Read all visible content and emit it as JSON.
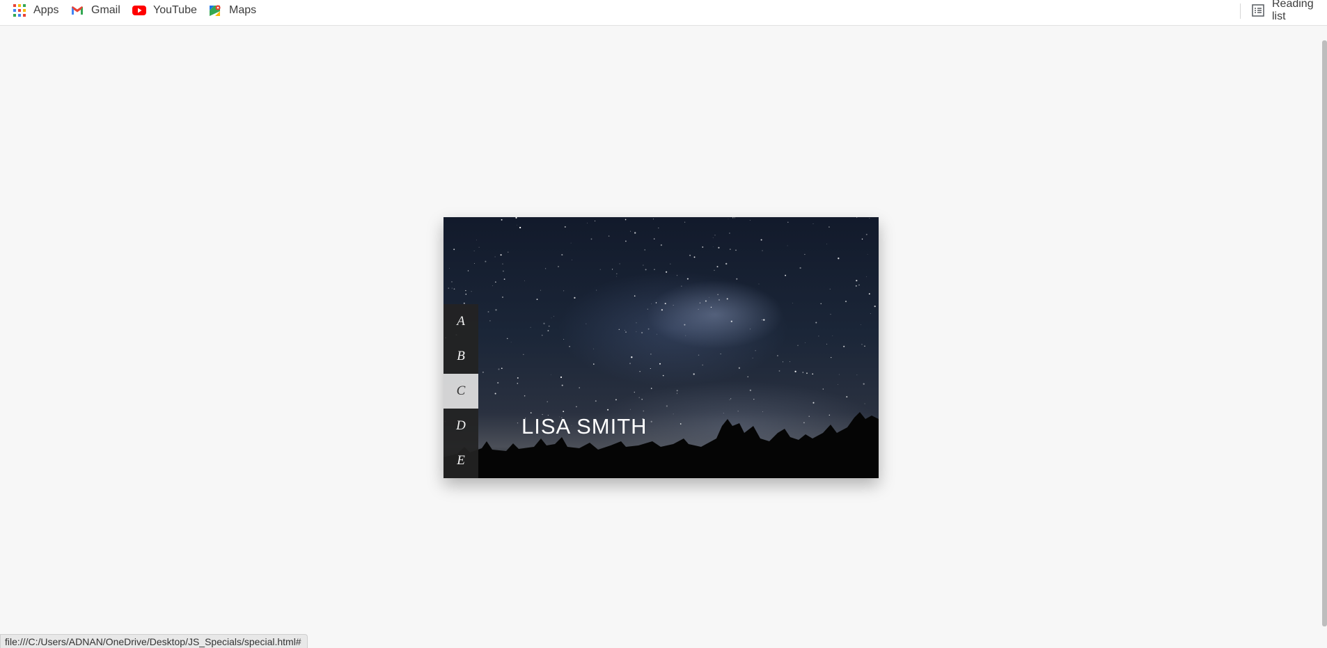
{
  "bookmarks": {
    "apps": "Apps",
    "gmail": "Gmail",
    "youtube": "YouTube",
    "maps": "Maps",
    "reading_list": "Reading list"
  },
  "profile_card": {
    "name": "LISA SMITH",
    "letters": [
      "A",
      "B",
      "C",
      "D",
      "E"
    ],
    "active_letter": "C"
  },
  "status_bar": {
    "url": "file:///C:/Users/ADNAN/OneDrive/Desktop/JS_Specials/special.html#"
  },
  "colors": {
    "gmail_red": "#ea4335",
    "youtube_red": "#ff0000",
    "active_tab": "#dcdcdc"
  }
}
